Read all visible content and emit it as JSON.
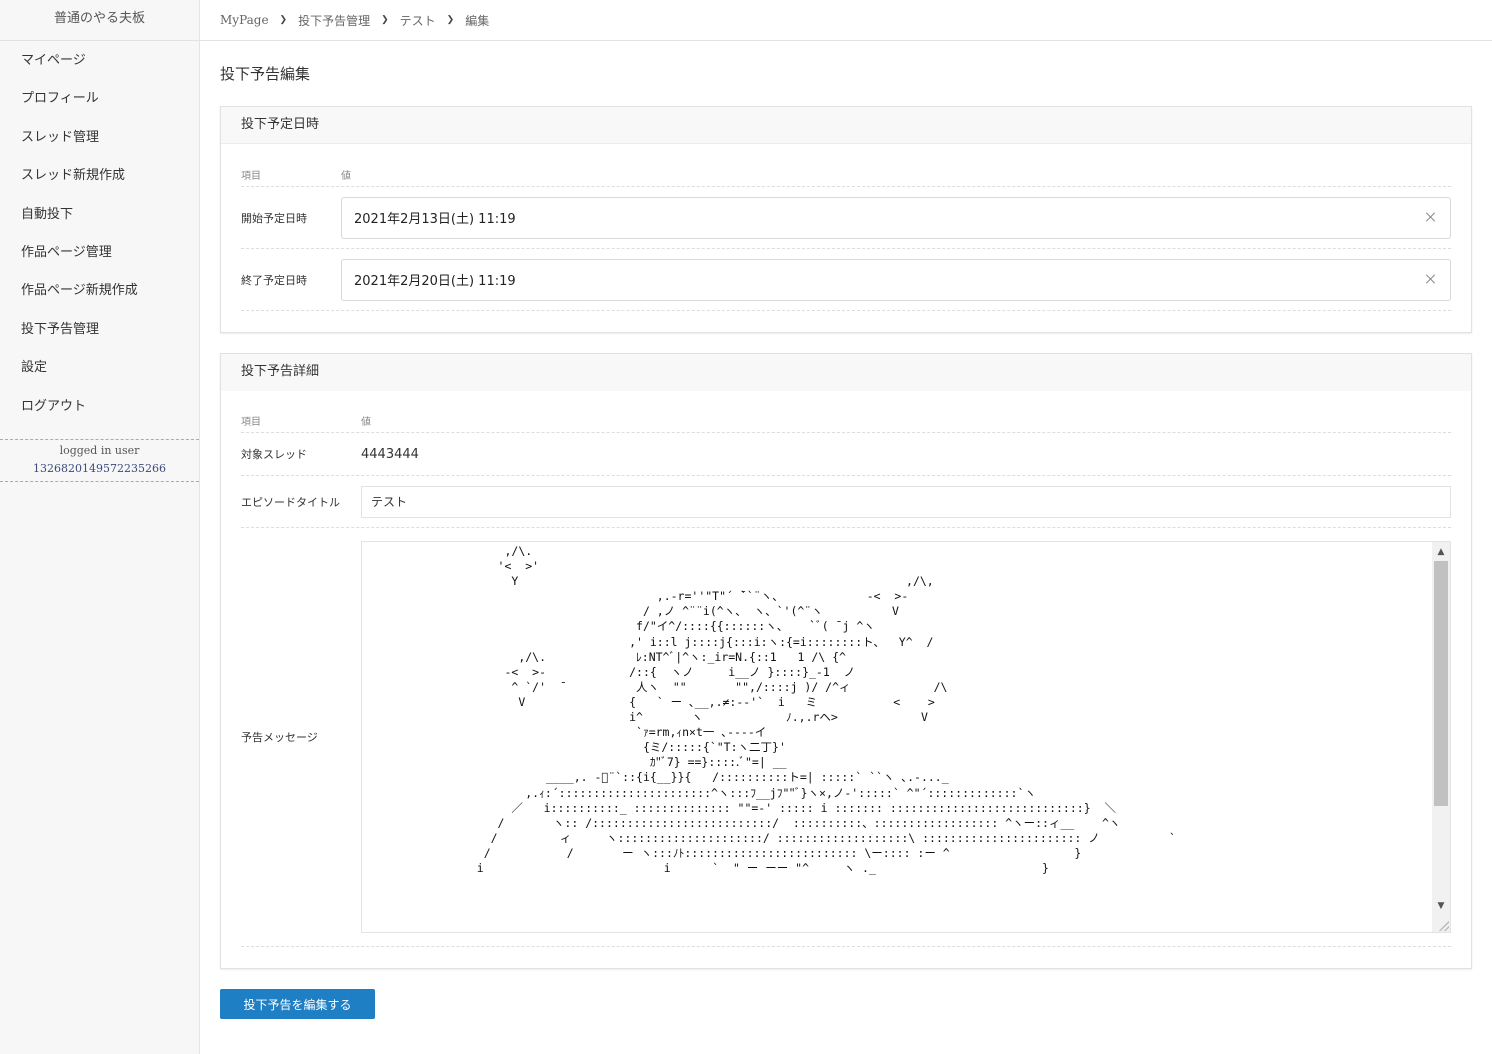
{
  "sidebar": {
    "brand": "普通のやる夫板",
    "items": [
      {
        "label": "マイページ"
      },
      {
        "label": "プロフィール"
      },
      {
        "label": "スレッド管理"
      },
      {
        "label": "スレッド新規作成"
      },
      {
        "label": "自動投下"
      },
      {
        "label": "作品ページ管理"
      },
      {
        "label": "作品ページ新規作成"
      },
      {
        "label": "投下予告管理"
      },
      {
        "label": "設定"
      },
      {
        "label": "ログアウト"
      }
    ],
    "user_caption": "logged in user",
    "user_id": "1326820149572235266"
  },
  "breadcrumb": [
    "MyPage",
    "投下予告管理",
    "テスト",
    "編集"
  ],
  "page_title": "投下予告編集",
  "schedule_card": {
    "title": "投下予定日時",
    "col_item": "項目",
    "col_value": "値",
    "start_label": "開始予定日時",
    "start_value": "2021年2月13日(土) 11:19",
    "end_label": "終了予定日時",
    "end_value": "2021年2月20日(土) 11:19"
  },
  "detail_card": {
    "title": "投下予告詳細",
    "col_item": "項目",
    "col_value": "値",
    "thread_label": "対象スレッド",
    "thread_value": "4443444",
    "episode_label": "エピソードタイトル",
    "episode_value": "テスト",
    "message_label": "予告メッセージ",
    "message_value": "                    ,/\\.\n                   '<  >'\n                     Y                                                        ,/\\,\n                                          ,.-r=''\"T\"´ ̄``¨ヽ、            -<  >-\n                                        / ,ノ ^¨¨i(^ヽ、 ヽ、`'(^¨ヽ          V\n                                       f/\"イ^/::::{{::::::ヽ、   `ﾞ( ̄ j ^ヽ\n                                      ,' i::l j::::j{:::i:ヽ:{=i::::::::ト、  Y^  /\n                      ,/\\.             ﾚ:NT^ﾞ|^ヽ:_ir=N.{::1   1 /\\ {^\n                    -<  >-            /::{  ヽノ     i__ノ }::::}_-1  ノ\n                     ^ `/'  ̄           人ヽ  \"\"       \"\",/::::j )/ /^ィ            /\\\n                      V               {   ` ー ､__,.≠:--'`  i   ミ           <    >\n                                      i^       ヽ            ﾉ.,.rヘ>            V\n                                       `ｧ=rm,ｨn×t一 ､----イ\n                                        {ミ/:::::{`\"T:ヽ二丁}'\n                                         ｶ\"ﾞ7} ==}::::.ﾞ\"=| __\n                          ____,. -ﾞ¨`::{i{__}}{   /::::::::::ト=| :::::` ``ヽ ､.-..._\n                       ,.ｨ:´::::::::::::::::::::::^ヽ:::ﾌ__jﾌ\"\"ﾞ}ヽ×,ノ-':::::` ^\"´:::::::::::::`ヽ\n                     ／   i::::::::::_ :::::::::::::: \"\"=-' ::::: i ::::::: ::::::::::::::::::::::::::::}  ＼\n                   /       ヽ:: /::::::::::::::::::::::::::/  ::::::::::、:::::::::::::::::: ^ヽー::ィ__    ^ヽ\n                  /         ィ     ヽ:::::::::::::::::::::/ :::::::::::::::::::\\ ::::::::::::::::::::::: ノ          `\n                 /           /       ー ヽ:::ﾉﾄ::::::::::::::::::::::::: \\ー:::: :ー ^                  }\n                i                          i      `  \" ー ーー \"^     ヽ ._                        }"
  },
  "submit_label": "投下予告を編集する"
}
